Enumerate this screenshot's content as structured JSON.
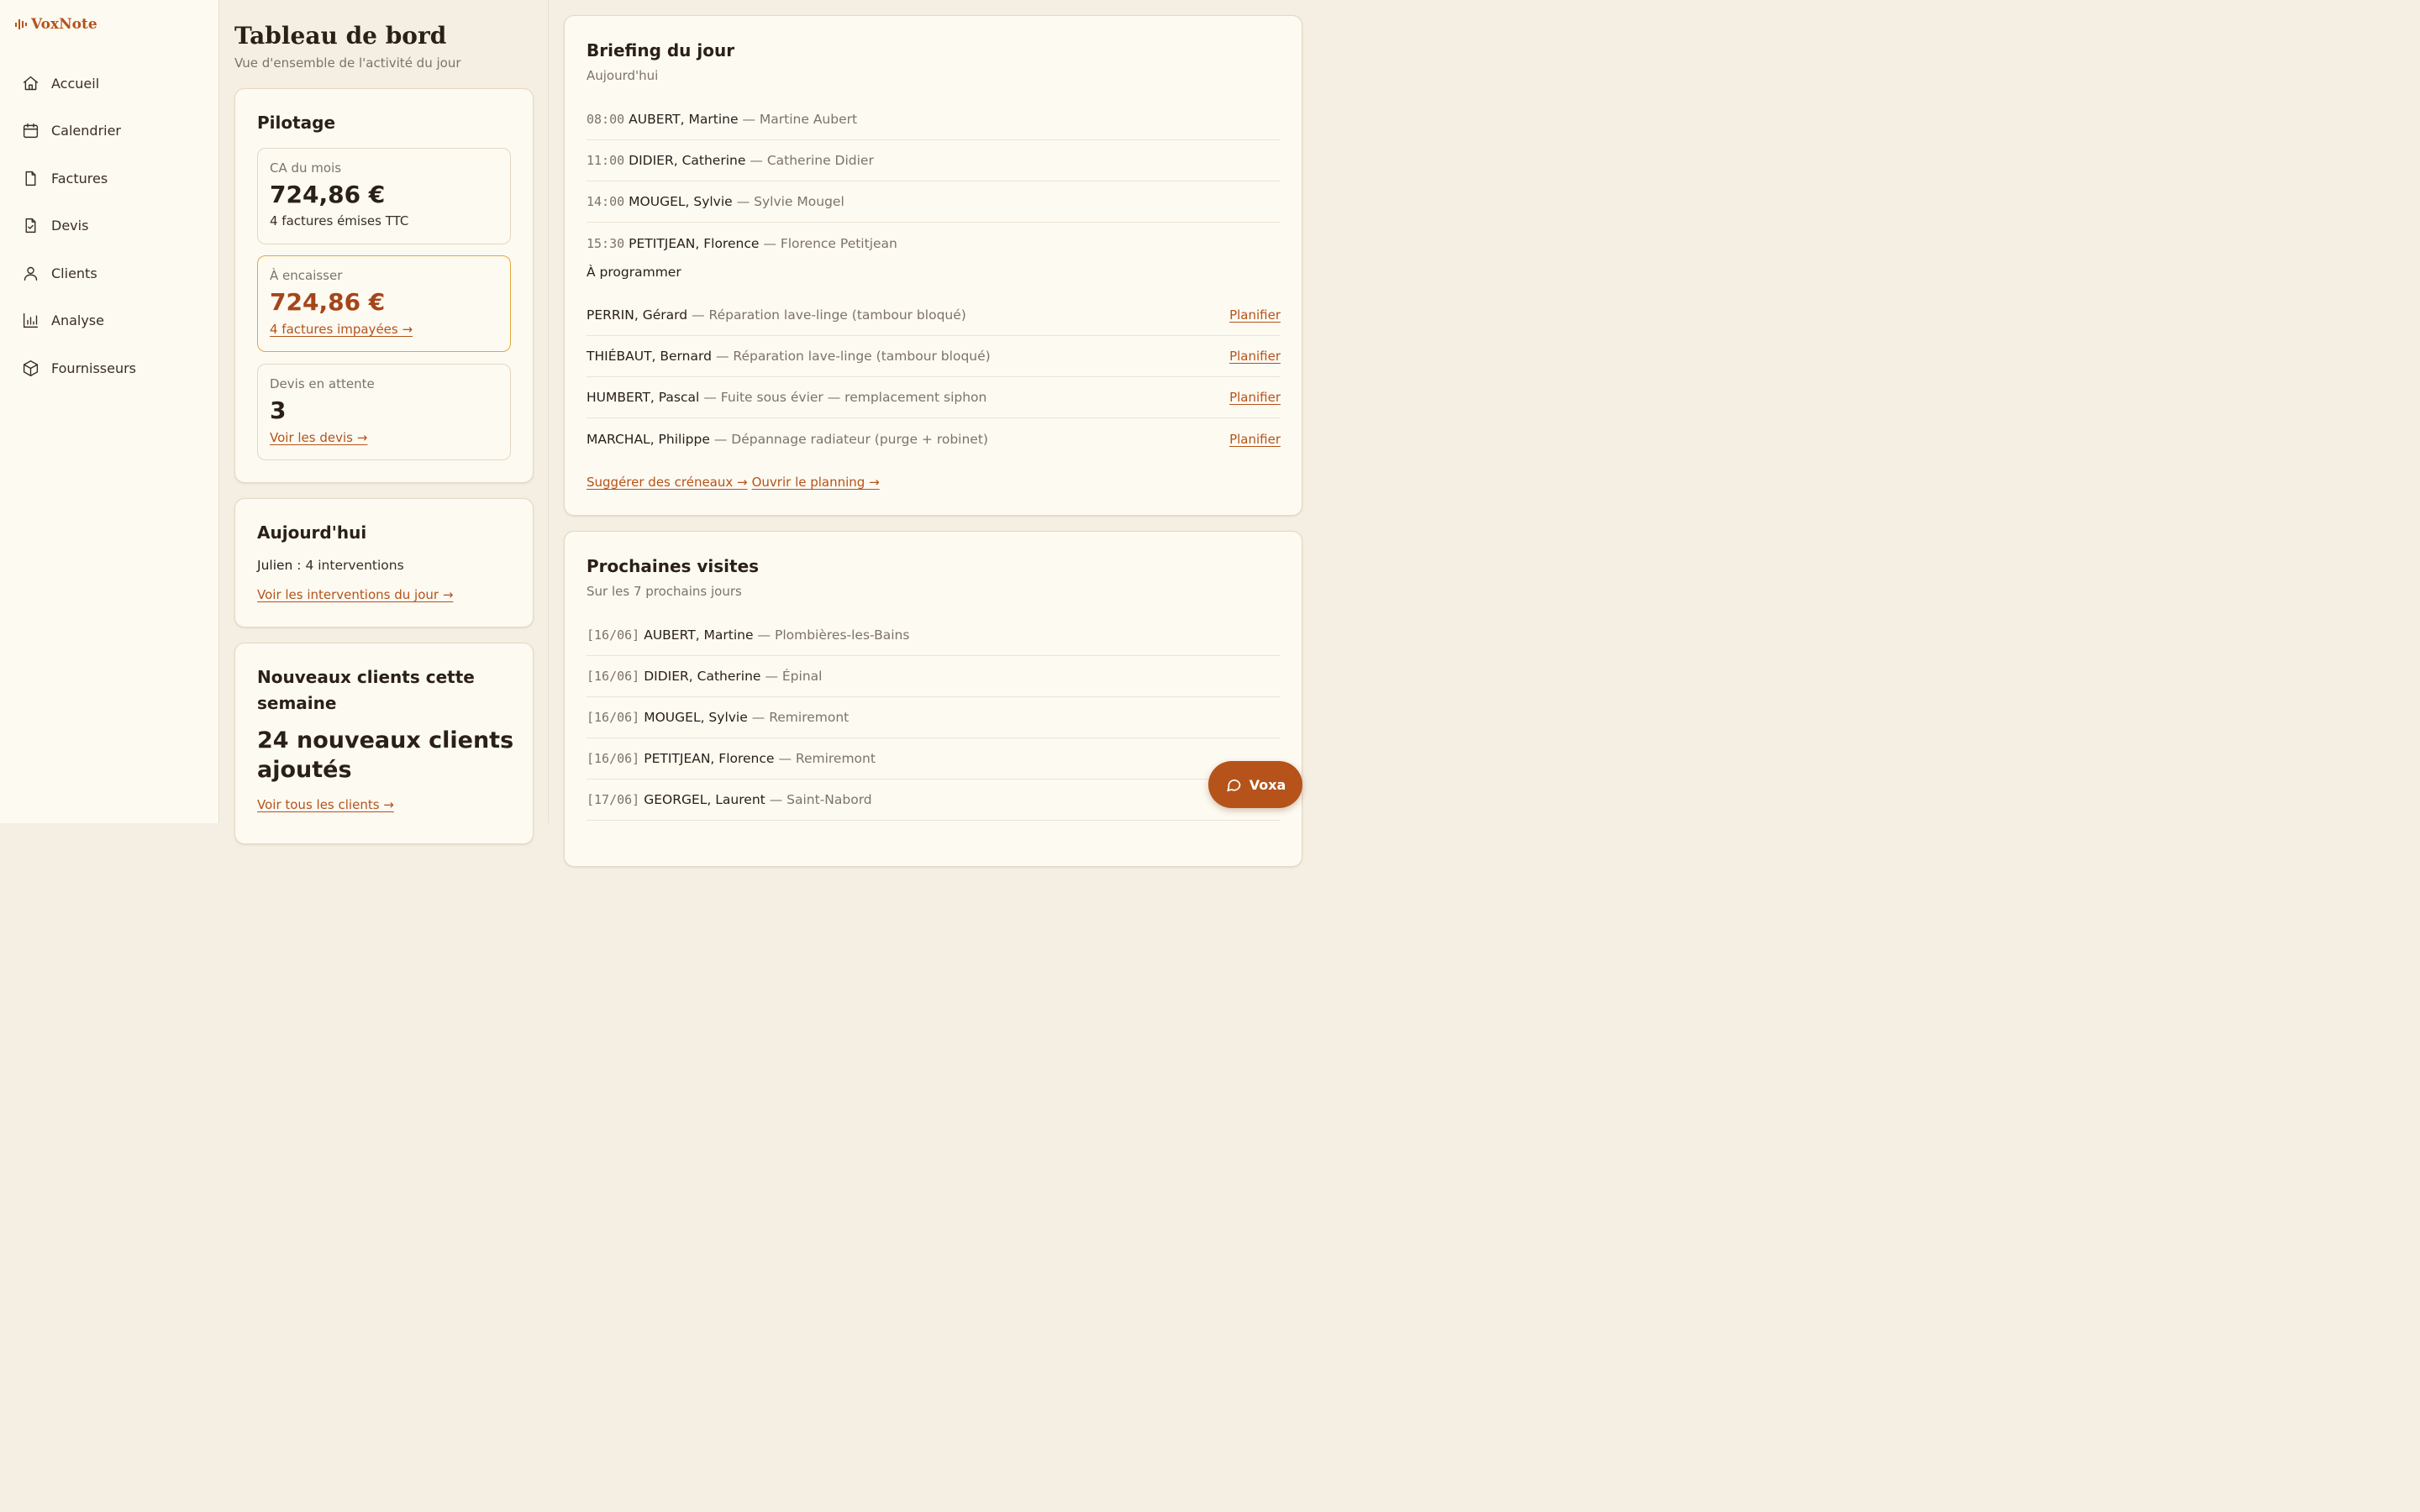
{
  "app": {
    "name": "VoxNote",
    "brand_color": "#b5531a"
  },
  "sidebar": {
    "items": [
      {
        "label": "Accueil",
        "icon": "home-icon"
      },
      {
        "label": "Calendrier",
        "icon": "calendar-icon"
      },
      {
        "label": "Factures",
        "icon": "file-icon"
      },
      {
        "label": "Devis",
        "icon": "file-check-icon"
      },
      {
        "label": "Clients",
        "icon": "user-icon"
      },
      {
        "label": "Analyse",
        "icon": "bar-chart-icon"
      },
      {
        "label": "Fournisseurs",
        "icon": "box-icon"
      }
    ]
  },
  "header": {
    "title": "Tableau de bord",
    "subtitle": "Vue d'ensemble de l'activité du jour"
  },
  "pilotage": {
    "title": "Pilotage",
    "ca": {
      "label": "CA du mois",
      "value": "724,86 €",
      "note": "4 factures émises TTC"
    },
    "encaisser": {
      "label": "À encaisser",
      "value": "724,86 €",
      "link": "4 factures impayées →"
    },
    "devis": {
      "label": "Devis en attente",
      "value": "3",
      "link": "Voir les devis →"
    }
  },
  "today": {
    "title": "Aujourd'hui",
    "tech_name": "Julien",
    "tech_count": " : 4 interventions",
    "link": "Voir les interventions du jour →"
  },
  "new_clients": {
    "title": "Nouveaux clients cette semaine",
    "value": "24 nouveaux clients ajoutés",
    "link": "Voir tous les clients →"
  },
  "briefing": {
    "title": "Briefing du jour",
    "subtitle": "Aujourd'hui",
    "appointments": [
      {
        "time": "08:00",
        "name": "AUBERT, Martine",
        "desc": "— Martine Aubert"
      },
      {
        "time": "11:00",
        "name": "DIDIER, Catherine",
        "desc": "— Catherine Didier"
      },
      {
        "time": "14:00",
        "name": "MOUGEL, Sylvie",
        "desc": "— Sylvie Mougel"
      },
      {
        "time": "15:30",
        "name": "PETITJEAN, Florence",
        "desc": "— Florence Petitjean"
      }
    ],
    "to_schedule_label": "À programmer",
    "to_schedule": [
      {
        "name": "PERRIN, Gérard",
        "desc": "— Réparation lave-linge (tambour bloqué)",
        "action": "Planifier"
      },
      {
        "name": "THIÉBAUT, Bernard",
        "desc": "— Réparation lave-linge (tambour bloqué)",
        "action": "Planifier"
      },
      {
        "name": "HUMBERT, Pascal",
        "desc": "— Fuite sous évier — remplacement siphon",
        "action": "Planifier"
      },
      {
        "name": "MARCHAL, Philippe",
        "desc": "— Dépannage radiateur (purge + robinet)",
        "action": "Planifier"
      }
    ],
    "suggest_link": "Suggérer des créneaux →",
    "planning_link": "Ouvrir le planning →"
  },
  "visits": {
    "title": "Prochaines visites",
    "subtitle": "Sur les 7 prochains jours",
    "items": [
      {
        "date": "[16/06]",
        "name": "AUBERT, Martine",
        "desc": "— Plombières-les-Bains"
      },
      {
        "date": "[16/06]",
        "name": "DIDIER, Catherine",
        "desc": "— Épinal"
      },
      {
        "date": "[16/06]",
        "name": "MOUGEL, Sylvie",
        "desc": "— Remiremont"
      },
      {
        "date": "[16/06]",
        "name": "PETITJEAN, Florence",
        "desc": "— Remiremont"
      },
      {
        "date": "[17/06]",
        "name": "GEORGEL, Laurent",
        "desc": "— Saint-Nabord"
      }
    ]
  },
  "assistant": {
    "label": "Voxa",
    "icon": "chat-icon"
  }
}
